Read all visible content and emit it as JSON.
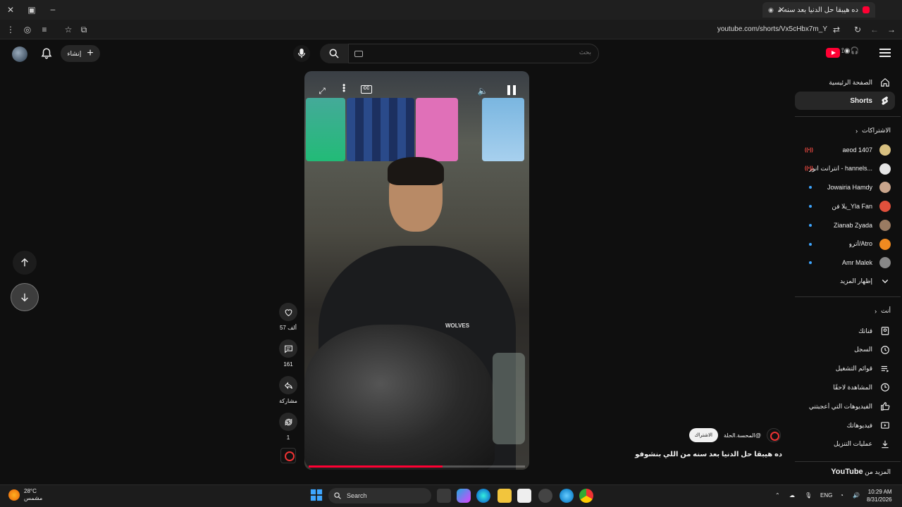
{
  "browser": {
    "tab_title": "ده هيبقا حل الدنيا بعد سنه من",
    "url": "youtube.com/shorts/Vx5cHbx7m_Y"
  },
  "header": {
    "create_label": "إنشاء",
    "search_placeholder": "بحث"
  },
  "video": {
    "likes": "57 ألف",
    "comments": "161",
    "share_label": "مشاركة",
    "remix_count": "1",
    "shirt_text": "WOLVES",
    "progress": 0.62,
    "title": "ده هيبقا حل الدنيا بعد سنه من اللي بنشوفو"
  },
  "channel": {
    "handle": "@المحسة.الحلة",
    "subscribe_label": "الاشتراك"
  },
  "sidebar": {
    "home": "الصفحة الرئيسية",
    "shorts": "Shorts",
    "subscriptions_header": "الاشتراكات",
    "subscriptions": [
      {
        "name": "aeod 1407",
        "marker": "live",
        "color": "#d8c080"
      },
      {
        "name": "...hannels - انترانت انور",
        "marker": "live",
        "color": "#e6e6e6"
      },
      {
        "name": "Jowairia Hamdy",
        "marker": "dot",
        "color": "#c9a58c"
      },
      {
        "name": "Yla Fan_يلا فن",
        "marker": "dot",
        "color": "#e0503c"
      },
      {
        "name": "Zianab Zyada",
        "marker": "dot",
        "color": "#9a7b62"
      },
      {
        "name": "Atro/أترو",
        "marker": "dot",
        "color": "#f08a20"
      },
      {
        "name": "Amr Malek",
        "marker": "dot",
        "color": "#888888"
      }
    ],
    "show_more": "إظهار المزيد",
    "you_header": "أنت",
    "you_items": [
      {
        "label": "قناتك",
        "icon": "channel-icon"
      },
      {
        "label": "السجل",
        "icon": "history-icon"
      },
      {
        "label": "قوائم التشغيل",
        "icon": "playlists-icon"
      },
      {
        "label": "المشاهدة لاحقًا",
        "icon": "watch-later-icon"
      },
      {
        "label": "الفيديوهات التي أعجبتني",
        "icon": "liked-icon"
      },
      {
        "label": "فيديوهاتك",
        "icon": "your-videos-icon"
      },
      {
        "label": "عمليات التنزيل",
        "icon": "download-icon"
      }
    ],
    "more_from_prefix": "المزيد من",
    "more_from_brand": "YouTube"
  },
  "taskbar": {
    "temperature": "28°C",
    "weather_desc": "مشمس",
    "search_label": "Search",
    "lang": "ENG",
    "time": "10:29 AM",
    "date": "8/31/2026"
  }
}
